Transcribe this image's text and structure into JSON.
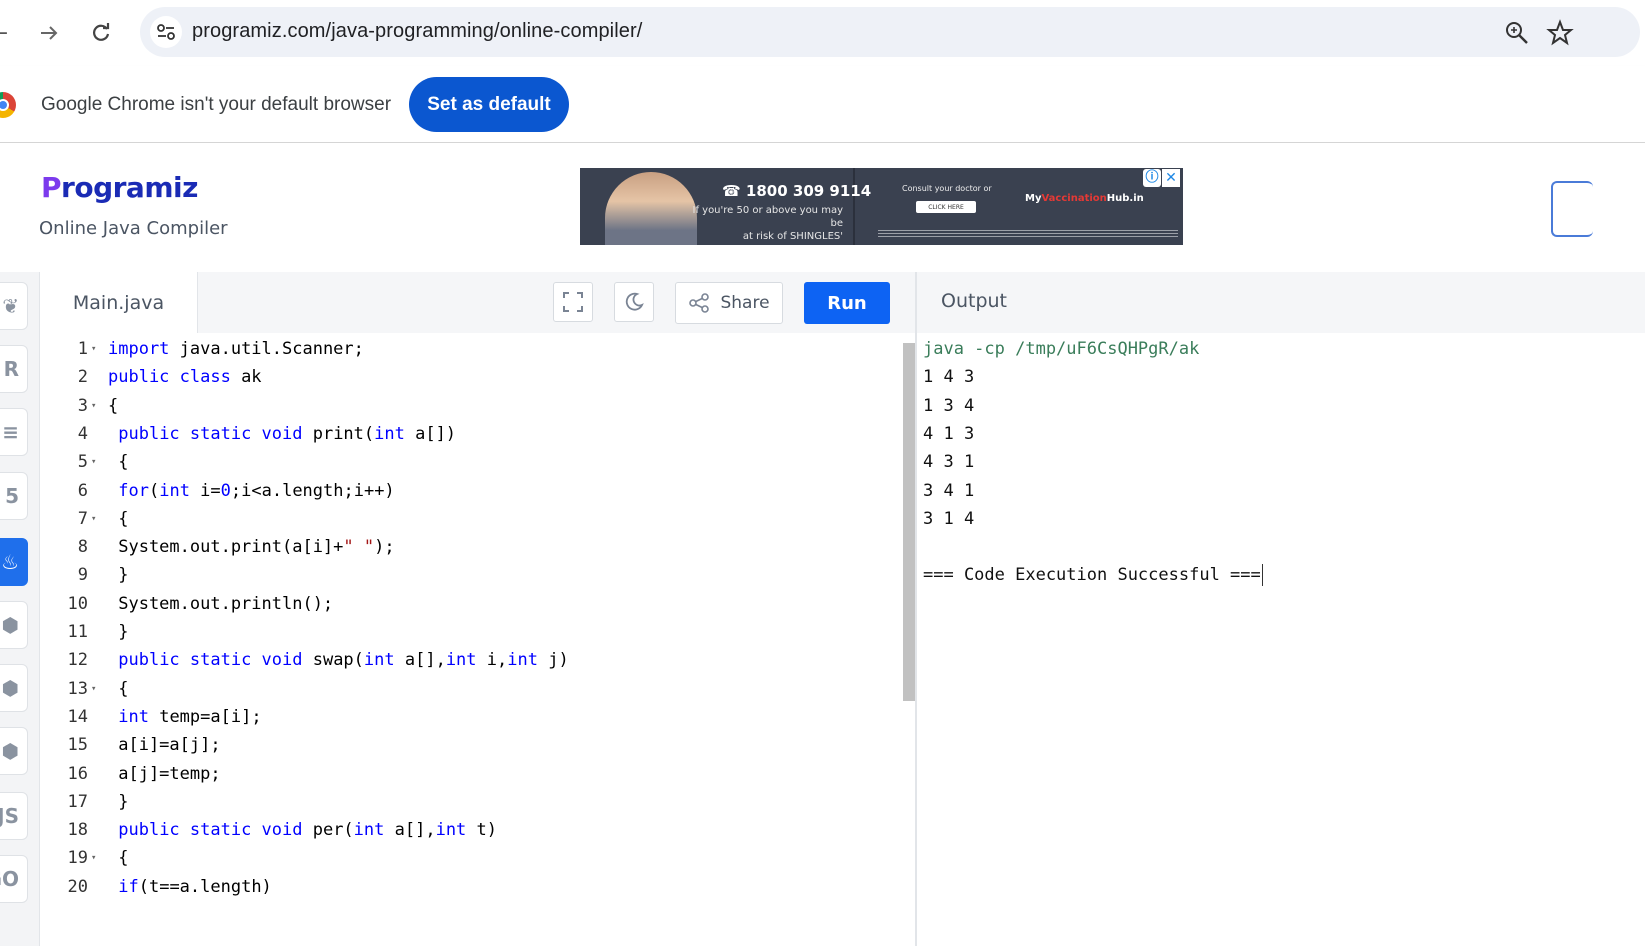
{
  "browser": {
    "url": "programiz.com/java-programming/online-compiler/",
    "icons": [
      "back-arrow-icon",
      "forward-arrow-icon",
      "reload-icon",
      "site-settings-icon",
      "zoom-icon",
      "bookmark-star-icon"
    ]
  },
  "infobar": {
    "message": "Google Chrome isn't your default browser",
    "button_label": "Set as default"
  },
  "site": {
    "logo_first": "P",
    "logo_rest": "rogramiz",
    "subtitle": "Online Java Compiler"
  },
  "ad": {
    "phone": "☎ 1800 309 9114",
    "line1": "If you're 50 or above you may be",
    "line2": "at risk of SHINGLES'",
    "consult": "Consult your doctor or",
    "cta": "CLICK HERE",
    "brand_pre": "My",
    "brand_highlight": "Vaccination",
    "brand_post": "Hub.in"
  },
  "editor": {
    "file_name": "Main.java",
    "share_label": "Share",
    "run_label": "Run",
    "lines": [
      {
        "n": "1",
        "fold": true
      },
      {
        "n": "2",
        "fold": false
      },
      {
        "n": "3",
        "fold": true
      },
      {
        "n": "4",
        "fold": false
      },
      {
        "n": "5",
        "fold": true
      },
      {
        "n": "6",
        "fold": false
      },
      {
        "n": "7",
        "fold": true
      },
      {
        "n": "8",
        "fold": false
      },
      {
        "n": "9",
        "fold": false
      },
      {
        "n": "10",
        "fold": false
      },
      {
        "n": "11",
        "fold": false
      },
      {
        "n": "12",
        "fold": false
      },
      {
        "n": "13",
        "fold": true
      },
      {
        "n": "14",
        "fold": false
      },
      {
        "n": "15",
        "fold": false
      },
      {
        "n": "16",
        "fold": false
      },
      {
        "n": "17",
        "fold": false
      },
      {
        "n": "18",
        "fold": false
      },
      {
        "n": "19",
        "fold": true
      },
      {
        "n": "20",
        "fold": false
      }
    ],
    "code": [
      [
        [
          "kw",
          "import"
        ],
        [
          "t",
          " java.util.Scanner;"
        ]
      ],
      [
        [
          "kw",
          "public class"
        ],
        [
          "t",
          " ak"
        ]
      ],
      [
        [
          "t",
          "{"
        ]
      ],
      [
        [
          "t",
          " "
        ],
        [
          "kw",
          "public static void"
        ],
        [
          "t",
          " print("
        ],
        [
          "kw",
          "int"
        ],
        [
          "t",
          " a[])"
        ]
      ],
      [
        [
          "t",
          " {"
        ]
      ],
      [
        [
          "t",
          " "
        ],
        [
          "kw",
          "for"
        ],
        [
          "t",
          "("
        ],
        [
          "kw",
          "int"
        ],
        [
          "t",
          " i="
        ],
        [
          "num",
          "0"
        ],
        [
          "t",
          ";i<a.length;i++)"
        ]
      ],
      [
        [
          "t",
          " {"
        ]
      ],
      [
        [
          "t",
          " System.out.print(a[i]+"
        ],
        [
          "str",
          "\" \""
        ],
        [
          "t",
          ");"
        ]
      ],
      [
        [
          "t",
          " }"
        ]
      ],
      [
        [
          "t",
          " System.out.println();"
        ]
      ],
      [
        [
          "t",
          " }"
        ]
      ],
      [
        [
          "t",
          " "
        ],
        [
          "kw",
          "public static void"
        ],
        [
          "t",
          " swap("
        ],
        [
          "kw",
          "int"
        ],
        [
          "t",
          " a[],"
        ],
        [
          "kw",
          "int"
        ],
        [
          "t",
          " i,"
        ],
        [
          "kw",
          "int"
        ],
        [
          "t",
          " j)"
        ]
      ],
      [
        [
          "t",
          " {"
        ]
      ],
      [
        [
          "t",
          " "
        ],
        [
          "kw",
          "int"
        ],
        [
          "t",
          " temp=a[i];"
        ]
      ],
      [
        [
          "t",
          " a[i]=a[j];"
        ]
      ],
      [
        [
          "t",
          " a[j]=temp;"
        ]
      ],
      [
        [
          "t",
          " }"
        ]
      ],
      [
        [
          "t",
          " "
        ],
        [
          "kw",
          "public static void"
        ],
        [
          "t",
          " per("
        ],
        [
          "kw",
          "int"
        ],
        [
          "t",
          " a[],"
        ],
        [
          "kw",
          "int"
        ],
        [
          "t",
          " t)"
        ]
      ],
      [
        [
          "t",
          " {"
        ]
      ],
      [
        [
          "t",
          " "
        ],
        [
          "kw",
          "if"
        ],
        [
          "t",
          "(t==a.length)"
        ]
      ]
    ]
  },
  "output": {
    "title": "Output",
    "command": "java -cp /tmp/uF6CsQHPgR/ak",
    "lines": [
      "1 4 3",
      "1 3 4",
      "4 1 3",
      "4 3 1",
      "3 4 1",
      "3 1 4",
      "",
      "=== Code Execution Successful ==="
    ]
  },
  "sidebar": {
    "languages": [
      {
        "icon": "python-icon",
        "glyph": "❦",
        "active": false
      },
      {
        "icon": "r-icon",
        "glyph": "R",
        "active": false
      },
      {
        "icon": "sql-icon",
        "glyph": "≡",
        "active": false
      },
      {
        "icon": "html-icon",
        "glyph": "5",
        "active": false
      },
      {
        "icon": "java-icon",
        "glyph": "♨",
        "active": true
      },
      {
        "icon": "c-icon",
        "glyph": "⬢",
        "active": false
      },
      {
        "icon": "cpp-icon",
        "glyph": "⬢",
        "active": false
      },
      {
        "icon": "csharp-icon",
        "glyph": "⬢",
        "active": false
      },
      {
        "icon": "js-icon",
        "glyph": "JS",
        "active": false
      },
      {
        "icon": "go-icon",
        "glyph": "GO",
        "active": false
      }
    ]
  },
  "colors": {
    "run": "#0d63f3",
    "set_default": "#0b57d0",
    "keyword": "#0000ff",
    "string": "#a31515",
    "output_command": "#3a7d5a"
  }
}
